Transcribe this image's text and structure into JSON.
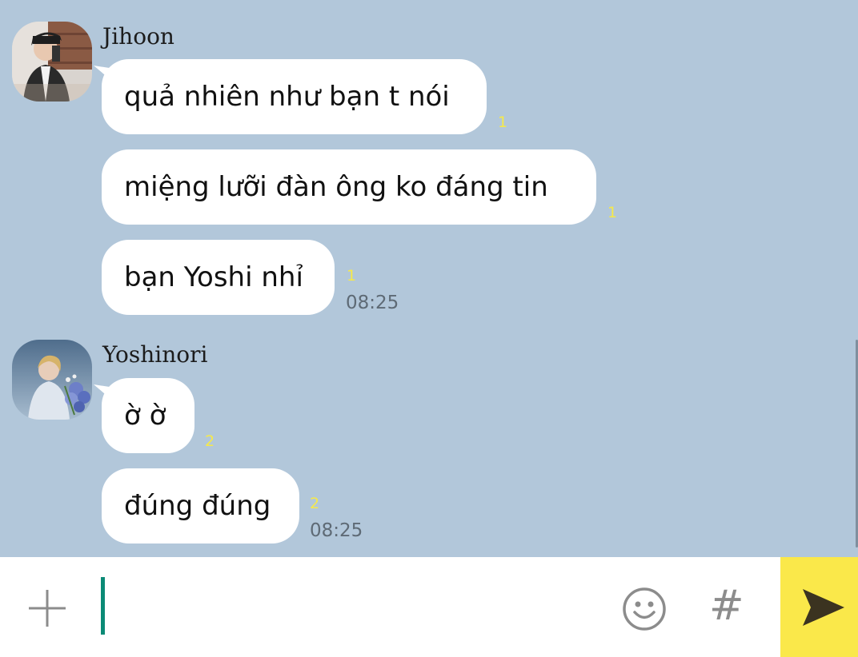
{
  "colors": {
    "chat_background": "#b2c7da",
    "bubble": "#ffffff",
    "unread_count": "#f6e94a",
    "send_button": "#fae84a",
    "caret": "#0b8a76"
  },
  "messages": {
    "group1": {
      "sender": "Jihoon",
      "avatar_icon": "profile-photo",
      "items": [
        {
          "text": "quả nhiên như bạn t nói",
          "unread": "1"
        },
        {
          "text": "miệng lưỡi đàn ông ko đáng tin",
          "unread": "1"
        },
        {
          "text": "bạn Yoshi nhỉ",
          "unread": "1",
          "time": "08:25"
        }
      ]
    },
    "group2": {
      "sender": "Yoshinori",
      "avatar_icon": "profile-photo",
      "items": [
        {
          "text": "ờ ờ",
          "unread": "2"
        },
        {
          "text": "đúng đúng",
          "unread": "2",
          "time": "08:25"
        }
      ]
    }
  },
  "input_bar": {
    "plus_icon": "plus-icon",
    "emoji_icon": "emoji-icon",
    "hash_label": "#",
    "send_icon": "send-icon",
    "value": ""
  }
}
